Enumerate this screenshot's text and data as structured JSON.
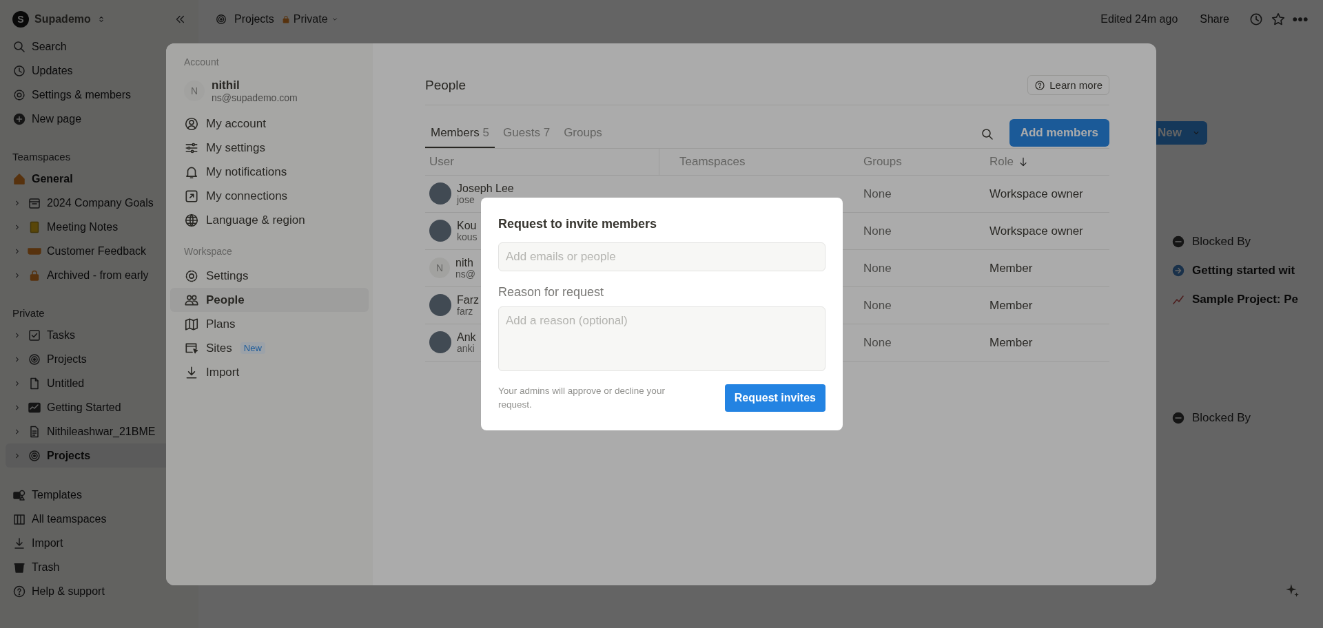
{
  "workspace": {
    "logo_letter": "S",
    "name": "Supademo"
  },
  "sidebar": {
    "top_items": [
      {
        "label": "Search"
      },
      {
        "label": "Updates"
      },
      {
        "label": "Settings & members"
      },
      {
        "label": "New page"
      }
    ],
    "teamspaces_label": "Teamspaces",
    "teamspace_home": {
      "label": "General"
    },
    "teamspace_pages": [
      {
        "label": "2024 Company Goals"
      },
      {
        "label": "Meeting Notes"
      },
      {
        "label": "Customer Feedback"
      },
      {
        "label": "Archived - from early"
      }
    ],
    "private_label": "Private",
    "private_pages": [
      {
        "label": "Tasks",
        "selected": false
      },
      {
        "label": "Projects",
        "selected": false
      },
      {
        "label": "Untitled",
        "selected": false
      },
      {
        "label": "Getting Started",
        "selected": false
      },
      {
        "label": "Nithileashwar_21BME",
        "selected": false
      },
      {
        "label": "Projects",
        "selected": true
      }
    ],
    "bottom_items": [
      {
        "label": "Templates"
      },
      {
        "label": "All teamspaces"
      },
      {
        "label": "Import"
      },
      {
        "label": "Trash"
      },
      {
        "label": "Help & support"
      }
    ]
  },
  "topbar": {
    "breadcrumb": "Projects",
    "privacy": "Private",
    "edited": "Edited 24m ago",
    "share": "Share"
  },
  "page": {
    "new_button": "New",
    "blocks": [
      {
        "items": [
          {
            "kind": "property",
            "label": "Blocked By"
          },
          {
            "kind": "relation",
            "label": "Getting started wit"
          },
          {
            "kind": "relation",
            "label": "Sample Project: Pe"
          }
        ]
      },
      {
        "items": [
          {
            "kind": "property",
            "label": "Blocked By"
          }
        ]
      }
    ]
  },
  "settings": {
    "account_label": "Account",
    "user": {
      "initial": "N",
      "name": "nithil",
      "email": "ns@supademo.com"
    },
    "account_items": [
      {
        "label": "My account",
        "selected": false
      },
      {
        "label": "My settings",
        "selected": false
      },
      {
        "label": "My notifications",
        "selected": false
      },
      {
        "label": "My connections",
        "selected": false
      },
      {
        "label": "Language & region",
        "selected": false
      }
    ],
    "workspace_label": "Workspace",
    "workspace_items": [
      {
        "label": "Settings",
        "selected": false
      },
      {
        "label": "People",
        "selected": true
      },
      {
        "label": "Plans",
        "selected": false
      },
      {
        "label": "Sites",
        "badge": "New",
        "selected": false
      },
      {
        "label": "Import",
        "selected": false
      }
    ],
    "title": "People",
    "learn_more": "Learn more",
    "tabs": [
      {
        "label": "Members",
        "count": "5",
        "selected": true
      },
      {
        "label": "Guests",
        "count": "7",
        "selected": false
      },
      {
        "label": "Groups",
        "selected": false
      }
    ],
    "add_button": "Add members",
    "table": {
      "columns": [
        "User",
        "Teamspaces",
        "Groups",
        "Role"
      ],
      "rows": [
        {
          "kind": "photo",
          "name": "Joseph Lee",
          "email": "jose",
          "groups": "None",
          "role": "Workspace owner"
        },
        {
          "kind": "photo",
          "name": "Kou",
          "email": "kous",
          "groups": "None",
          "role": "Workspace owner"
        },
        {
          "kind": "initial",
          "initial": "N",
          "name": "nith",
          "email": "ns@",
          "groups": "None",
          "role": "Member"
        },
        {
          "kind": "photo",
          "name": "Farz",
          "email": "farz",
          "groups": "None",
          "role": "Member"
        },
        {
          "kind": "photo",
          "name": "Ank",
          "email": "anki",
          "groups": "None",
          "role": "Member"
        }
      ]
    }
  },
  "dialog": {
    "title": "Request to invite members",
    "email_placeholder": "Add emails or people",
    "reason_label": "Reason for request",
    "reason_placeholder": "Add a reason (optional)",
    "note": "Your admins will approve or decline your request.",
    "button": "Request invites"
  }
}
